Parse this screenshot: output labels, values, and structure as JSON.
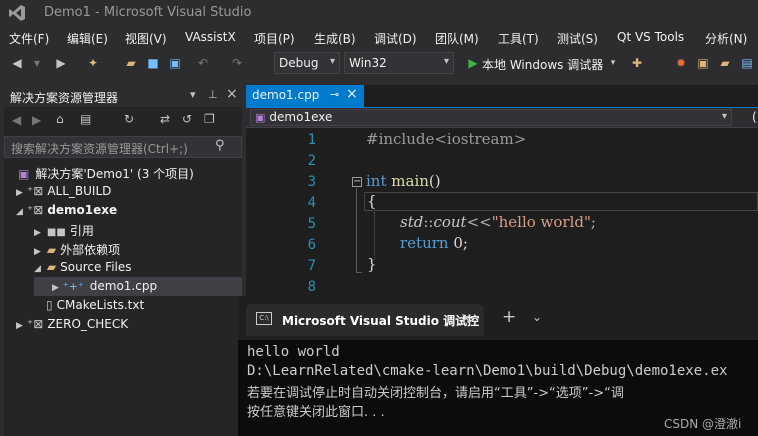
{
  "window": {
    "title": "Demo1 - Microsoft Visual Studio"
  },
  "menu": [
    "文件(F)",
    "编辑(E)",
    "视图(V)",
    "VAssistX",
    "项目(P)",
    "生成(B)",
    "调试(D)",
    "团队(M)",
    "工具(T)",
    "测试(S)",
    "Qt VS Tools",
    "分析(N)"
  ],
  "toolbar": {
    "config": "Debug",
    "platform": "Win32",
    "run_label": "本地 Windows 调试器"
  },
  "solution_explorer": {
    "title": "解决方案资源管理器",
    "search_placeholder": "搜索解决方案资源管理器(Ctrl+;)",
    "items": [
      {
        "label": "解决方案'Demo1' (3 个项目)"
      },
      {
        "label": "ALL_BUILD"
      },
      {
        "label": "demo1exe"
      },
      {
        "label": "引用"
      },
      {
        "label": "外部依赖项"
      },
      {
        "label": "Source Files"
      },
      {
        "label": "demo1.cpp"
      },
      {
        "label": "CMakeLists.txt"
      },
      {
        "label": "ZERO_CHECK"
      }
    ]
  },
  "editor": {
    "tab_label": "demo1.cpp",
    "tab_pin": "⊸",
    "tab_close": "×",
    "nav_scope": "demo1exe",
    "nav_right": "(",
    "line_numbers": [
      "1",
      "2",
      "3",
      "4",
      "5",
      "6",
      "7",
      "8"
    ],
    "code": {
      "l1": "#include<iostream>",
      "l3_kw": "int",
      "l3_fn": "main",
      "l3_rest": "()",
      "l4": "{",
      "l5_ns": "std",
      "l5_sep": "::",
      "l5_obj": "cout",
      "l5_op": "<<",
      "l5_str": "\"hello world\"",
      "l5_end": ";",
      "l6_kw": "return",
      "l6_rest": " 0;",
      "l7": "}"
    }
  },
  "console": {
    "tab_label": "Microsoft Visual Studio 调试控",
    "lines": [
      "hello world",
      "D:\\LearnRelated\\cmake-learn\\Demo1\\build\\Debug\\demo1exe.ex",
      "若要在调试停止时自动关闭控制台，请启用“工具”->“选项”->“调",
      "按任意键关闭此窗口. . ."
    ]
  },
  "watermark": "CSDN @澄澈i",
  "colors": {
    "accent": "#007acc",
    "bg": "#2d2d30",
    "editor_bg": "#1e1e1e",
    "console_bg": "#0c0c0c"
  }
}
